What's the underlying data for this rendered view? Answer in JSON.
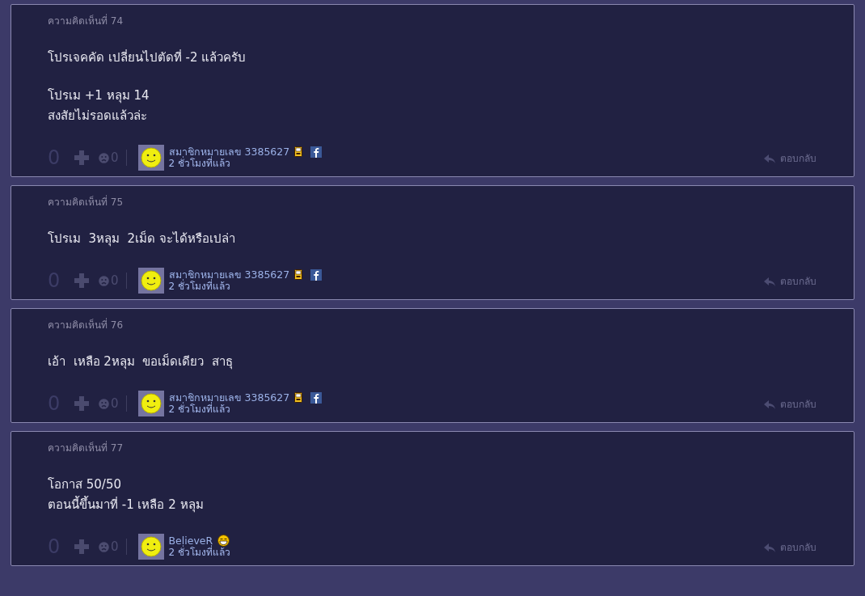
{
  "comments": [
    {
      "header": "ความคิดเห็นที่ 74",
      "paragraphs": [
        [
          "โปรเจคคัด เปลี่ยนไปตัดที่ -2 แล้วครับ"
        ],
        [
          "โปรเม +1 หลุม 14",
          "สงสัยไม่รอดแล้วล่ะ"
        ]
      ],
      "score": "0",
      "sad_count": "0",
      "author": "สมาชิกหมายเลข 3385627",
      "badges": [
        {
          "kind": "phone"
        },
        {
          "kind": "facebook"
        }
      ],
      "time": "2 ชั่วโมงที่แล้ว",
      "reply": "ตอบกลับ"
    },
    {
      "header": "ความคิดเห็นที่ 75",
      "paragraphs": [
        [
          "โปรเม  3หลุม  2เม็ด จะได้หรือเปล่า"
        ]
      ],
      "score": "0",
      "sad_count": "0",
      "author": "สมาชิกหมายเลข 3385627",
      "badges": [
        {
          "kind": "phone"
        },
        {
          "kind": "facebook"
        }
      ],
      "time": "2 ชั่วโมงที่แล้ว",
      "reply": "ตอบกลับ"
    },
    {
      "header": "ความคิดเห็นที่ 76",
      "paragraphs": [
        [
          "เอ้า  เหลือ 2หลุม  ขอเม็ดเดียว  สาธุ"
        ]
      ],
      "score": "0",
      "sad_count": "0",
      "author": "สมาชิกหมายเลข 3385627",
      "badges": [
        {
          "kind": "phone"
        },
        {
          "kind": "facebook"
        }
      ],
      "time": "2 ชั่วโมงที่แล้ว",
      "reply": "ตอบกลับ"
    },
    {
      "header": "ความคิดเห็นที่ 77",
      "paragraphs": [
        [
          "โอกาส 50/50",
          "ตอนนี้ขึ้นมาที่ -1 เหลือ 2 หลุม"
        ]
      ],
      "score": "0",
      "sad_count": "0",
      "author": "BelieveR",
      "badges": [
        {
          "kind": "laughing"
        }
      ],
      "time": "2 ชั่วโมงที่แล้ว",
      "reply": "ตอบกลับ"
    }
  ]
}
